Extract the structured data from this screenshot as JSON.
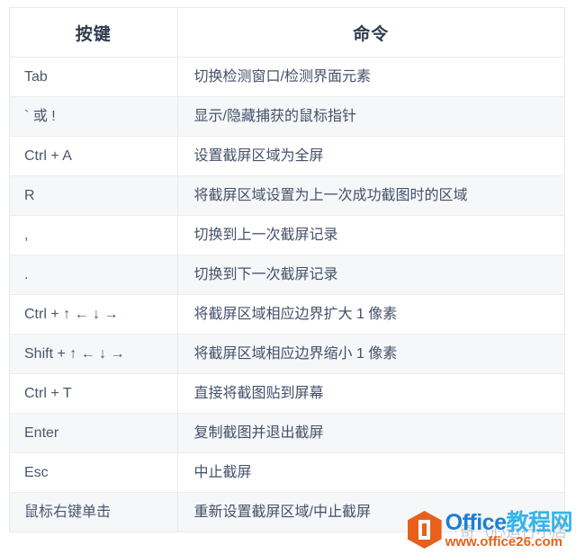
{
  "table": {
    "headers": {
      "key": "按键",
      "command": "命令"
    },
    "rows": [
      {
        "key": "Tab",
        "command": "切换检测窗口/检测界面元素"
      },
      {
        "key": "` 或 !",
        "command": "显示/隐藏捕获的鼠标指针"
      },
      {
        "key": "Ctrl + A",
        "command": "设置截屏区域为全屏"
      },
      {
        "key": "R",
        "command": "将截屏区域设置为上一次成功截图时的区域"
      },
      {
        "key": ",",
        "command": "切换到上一次截屏记录"
      },
      {
        "key": ".",
        "command": "切换到下一次截屏记录"
      },
      {
        "key": "Ctrl + ↑ ← ↓ →",
        "command": "将截屏区域相应边界扩大 1 像素"
      },
      {
        "key": "Shift + ↑ ← ↓ →",
        "command": "将截屏区域相应边界缩小 1 像素"
      },
      {
        "key": "Ctrl + T",
        "command": "直接将截图贴到屏幕"
      },
      {
        "key": "Enter",
        "command": "复制截图并退出截屏"
      },
      {
        "key": "Esc",
        "command": "中止截屏"
      },
      {
        "key": "鼠标右键单击",
        "command": "重新设置截屏区域/中止截屏"
      }
    ]
  },
  "watermark": {
    "brand_latin": "Office",
    "brand_cn": "教程网",
    "url": "www.office26.com",
    "ghost_text": "奇（心运行小店",
    "logo_color": "#e8601c",
    "brand_latin_color": "#1b7fd4",
    "brand_cn_color": "#35b4e8"
  },
  "colors": {
    "border": "#e8eaed",
    "row_alt_bg": "#f6f7f9",
    "text": "#44516a",
    "header_text": "#2f3b4d"
  }
}
